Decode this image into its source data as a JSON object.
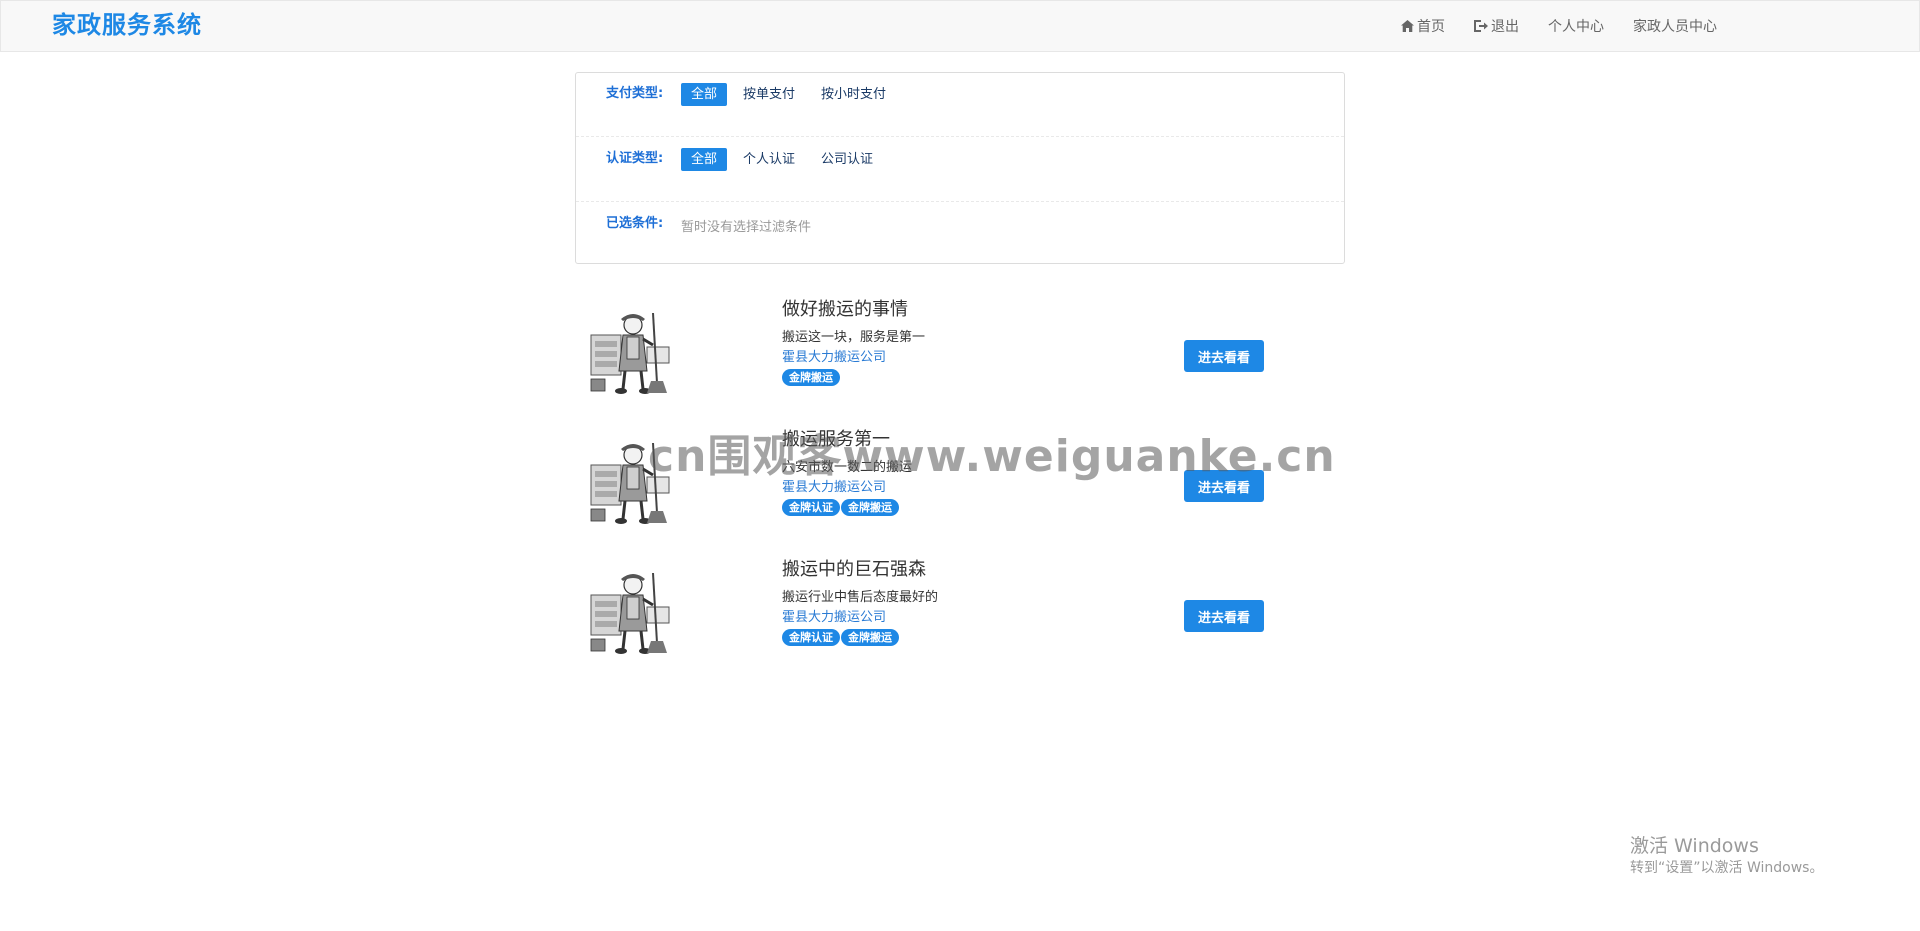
{
  "brand": "家政服务系统",
  "nav": {
    "home": "首页",
    "logout": "退出",
    "personal_center": "个人中心",
    "staff_center": "家政人员中心"
  },
  "filters": {
    "payment": {
      "label": "支付类型:",
      "options": [
        "全部",
        "按单支付",
        "按小时支付"
      ],
      "selected": "全部"
    },
    "certification": {
      "label": "认证类型:",
      "options": [
        "全部",
        "个人认证",
        "公司认证"
      ],
      "selected": "全部"
    },
    "chosen": {
      "label": "已选条件:",
      "empty_text": "暂时没有选择过滤条件"
    }
  },
  "listings": [
    {
      "title": "做好搬运的事情",
      "description": "搬运这一块，服务是第一",
      "company": "霍县大力搬运公司",
      "badges": [
        "金牌搬运"
      ],
      "button": "进去看看"
    },
    {
      "title": "搬运服务第一",
      "description": "六安市数一数二的搬运",
      "company": "霍县大力搬运公司",
      "badges": [
        "金牌认证",
        "金牌搬运"
      ],
      "button": "进去看看"
    },
    {
      "title": "搬运中的巨石强森",
      "description": "搬运行业中售后态度最好的",
      "company": "霍县大力搬运公司",
      "badges": [
        "金牌认证",
        "金牌搬运"
      ],
      "button": "进去看看"
    }
  ],
  "watermark": "cn围观客www.weiguanke.cn",
  "windows_activation": {
    "title": "激活 Windows",
    "subtitle": "转到“设置”以激活 Windows。"
  },
  "colors": {
    "brand": "#1e88e5",
    "accent": "#1e88e5",
    "label": "#1e6fd6",
    "link": "#2a7bd4"
  }
}
